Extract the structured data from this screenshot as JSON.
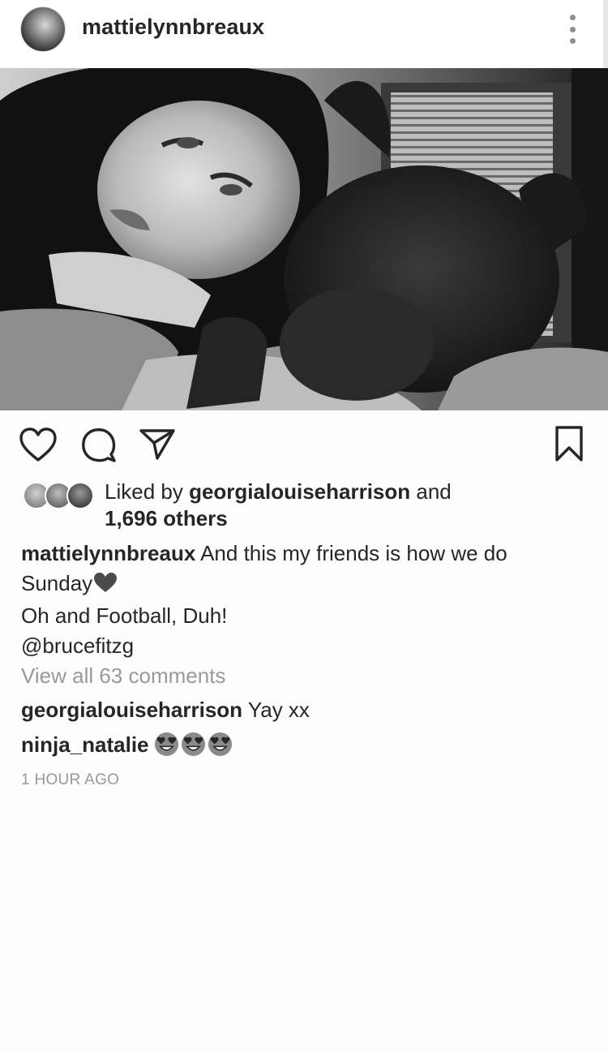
{
  "post": {
    "author": "mattielynnbreaux"
  },
  "actions": {
    "like_icon": "heart-outline-icon",
    "comment_icon": "comment-bubble-icon",
    "share_icon": "paper-plane-icon",
    "save_icon": "bookmark-icon"
  },
  "likes": {
    "prefix": "Liked by ",
    "first_user": "georgialouiseharrison",
    "conjunction": " and",
    "others": "1,696 others"
  },
  "caption": {
    "username": "mattielynnbreaux",
    "text_line1": " And this my friends is how we do",
    "text_line2": "Sunday",
    "emoji": "black-heart-emoji",
    "text_line3": "Oh and Football, Duh!",
    "text_line4": "@brucefitzg"
  },
  "comments": {
    "view_all": "View all 63 comments",
    "items": [
      {
        "username": "georgialouiseharrison",
        "text": " Yay xx"
      },
      {
        "username": "ninja_natalie",
        "emoji": "heart-eyes-emoji"
      }
    ]
  },
  "timestamp": "1 HOUR AGO",
  "colors": {
    "text": "#262626",
    "secondary": "#999999",
    "emoji_face": "#8a8a8a"
  }
}
